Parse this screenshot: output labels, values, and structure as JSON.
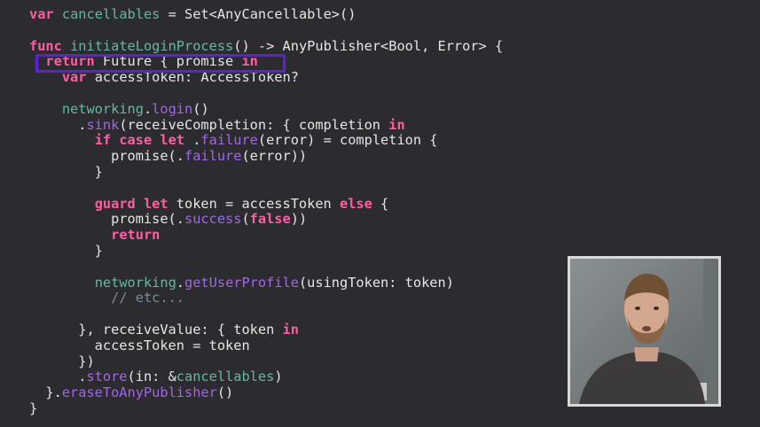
{
  "editor": {
    "lines": [
      [
        {
          "t": "var",
          "c": "kw"
        },
        {
          "t": " ",
          "c": "pl"
        },
        {
          "t": "cancellables",
          "c": "fn"
        },
        {
          "t": " = ",
          "c": "pl"
        },
        {
          "t": "Set<AnyCancellable>()",
          "c": "pl"
        }
      ],
      [],
      [
        {
          "t": "func",
          "c": "kw"
        },
        {
          "t": " ",
          "c": "pl"
        },
        {
          "t": "initiateLoginProcess",
          "c": "fn"
        },
        {
          "t": "() -> AnyPublisher<Bool, Error> {",
          "c": "pl"
        }
      ],
      [
        {
          "t": "  ",
          "c": "pl"
        },
        {
          "t": "return",
          "c": "kw"
        },
        {
          "t": " Future { promise ",
          "c": "pl"
        },
        {
          "t": "in",
          "c": "kw"
        }
      ],
      [
        {
          "t": "    ",
          "c": "pl"
        },
        {
          "t": "var",
          "c": "kw"
        },
        {
          "t": " accessToken: AccessToken?",
          "c": "pl"
        }
      ],
      [],
      [
        {
          "t": "    ",
          "c": "pl"
        },
        {
          "t": "networking",
          "c": "fn"
        },
        {
          "t": ".",
          "c": "pl"
        },
        {
          "t": "login",
          "c": "mt"
        },
        {
          "t": "()",
          "c": "pl"
        }
      ],
      [
        {
          "t": "      .",
          "c": "pl"
        },
        {
          "t": "sink",
          "c": "mt"
        },
        {
          "t": "(receiveCompletion: { completion ",
          "c": "pl"
        },
        {
          "t": "in",
          "c": "kw"
        }
      ],
      [
        {
          "t": "        ",
          "c": "pl"
        },
        {
          "t": "if case let",
          "c": "kw"
        },
        {
          "t": " .",
          "c": "pl"
        },
        {
          "t": "failure",
          "c": "mt"
        },
        {
          "t": "(error) = completion {",
          "c": "pl"
        }
      ],
      [
        {
          "t": "          promise(.",
          "c": "pl"
        },
        {
          "t": "failure",
          "c": "mt"
        },
        {
          "t": "(error))",
          "c": "pl"
        }
      ],
      [
        {
          "t": "        }",
          "c": "pl"
        }
      ],
      [],
      [
        {
          "t": "        ",
          "c": "pl"
        },
        {
          "t": "guard let",
          "c": "kw"
        },
        {
          "t": " token = accessToken ",
          "c": "pl"
        },
        {
          "t": "else",
          "c": "kw"
        },
        {
          "t": " {",
          "c": "pl"
        }
      ],
      [
        {
          "t": "          promise(.",
          "c": "pl"
        },
        {
          "t": "success",
          "c": "mt"
        },
        {
          "t": "(",
          "c": "pl"
        },
        {
          "t": "false",
          "c": "kw"
        },
        {
          "t": "))",
          "c": "pl"
        }
      ],
      [
        {
          "t": "          ",
          "c": "pl"
        },
        {
          "t": "return",
          "c": "kw"
        }
      ],
      [
        {
          "t": "        }",
          "c": "pl"
        }
      ],
      [],
      [
        {
          "t": "        ",
          "c": "pl"
        },
        {
          "t": "networking",
          "c": "fn"
        },
        {
          "t": ".",
          "c": "pl"
        },
        {
          "t": "getUserProfile",
          "c": "mt"
        },
        {
          "t": "(usingToken: token)",
          "c": "pl"
        }
      ],
      [
        {
          "t": "          ",
          "c": "pl"
        },
        {
          "t": "// etc...",
          "c": "cm"
        }
      ],
      [],
      [
        {
          "t": "      }, receiveValue: { token ",
          "c": "pl"
        },
        {
          "t": "in",
          "c": "kw"
        }
      ],
      [
        {
          "t": "        accessToken = token",
          "c": "pl"
        }
      ],
      [
        {
          "t": "      })",
          "c": "pl"
        }
      ],
      [
        {
          "t": "      .",
          "c": "pl"
        },
        {
          "t": "store",
          "c": "mt"
        },
        {
          "t": "(in: &",
          "c": "pl"
        },
        {
          "t": "cancellables",
          "c": "fn"
        },
        {
          "t": ")",
          "c": "pl"
        }
      ],
      [
        {
          "t": "  }.",
          "c": "pl"
        },
        {
          "t": "eraseToAnyPublisher",
          "c": "mt"
        },
        {
          "t": "()",
          "c": "pl"
        }
      ],
      [
        {
          "t": "}",
          "c": "pl"
        }
      ]
    ]
  },
  "colors": {
    "background": "#2b2b30",
    "keyword": "#fc5fa3",
    "highlight_border": "#5b22d6"
  },
  "webcam": {
    "icon": "presenter-video"
  }
}
